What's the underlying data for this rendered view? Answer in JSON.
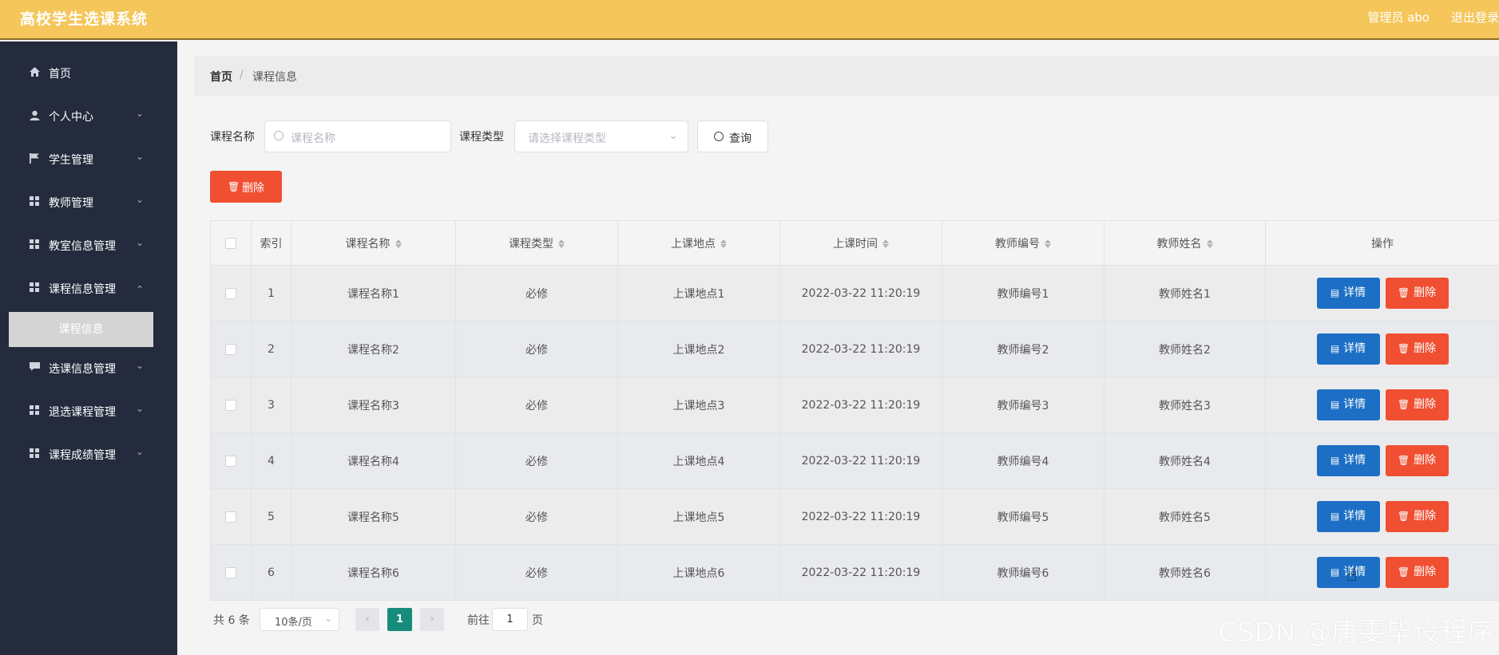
{
  "header": {
    "title": "高校学生选课系统",
    "user": "管理员 abo",
    "logout": "退出登录"
  },
  "sidebar": {
    "items": [
      {
        "label": "首页",
        "icon": "home-icon"
      },
      {
        "label": "个人中心",
        "icon": "user-icon"
      },
      {
        "label": "学生管理",
        "icon": "flag-icon"
      },
      {
        "label": "教师管理",
        "icon": "grid-icon"
      },
      {
        "label": "教室信息管理",
        "icon": "grid-icon"
      },
      {
        "label": "课程信息管理",
        "icon": "grid-icon"
      },
      {
        "label": "选课信息管理",
        "icon": "message-icon"
      },
      {
        "label": "退选课程管理",
        "icon": "grid-icon"
      },
      {
        "label": "课程成绩管理",
        "icon": "grid-icon"
      }
    ],
    "sub_item": "课程信息"
  },
  "breadcrumb": {
    "home": "首页",
    "separator": "/",
    "current": "课程信息"
  },
  "search": {
    "name_label": "课程名称",
    "name_placeholder": "课程名称",
    "type_label": "课程类型",
    "type_placeholder": "请选择课程类型",
    "query_button": "查询"
  },
  "actions": {
    "delete_button": "删除"
  },
  "table": {
    "headers": [
      "索引",
      "课程名称",
      "课程类型",
      "上课地点",
      "上课时间",
      "教师编号",
      "教师姓名",
      "操作"
    ],
    "detail_label": "详情",
    "delete_label": "删除",
    "rows": [
      {
        "index": "1",
        "name": "课程名称1",
        "type": "必修",
        "location": "上课地点1",
        "time": "2022-03-22 11:20:19",
        "teacher_no": "教师编号1",
        "teacher_name": "教师姓名1"
      },
      {
        "index": "2",
        "name": "课程名称2",
        "type": "必修",
        "location": "上课地点2",
        "time": "2022-03-22 11:20:19",
        "teacher_no": "教师编号2",
        "teacher_name": "教师姓名2"
      },
      {
        "index": "3",
        "name": "课程名称3",
        "type": "必修",
        "location": "上课地点3",
        "time": "2022-03-22 11:20:19",
        "teacher_no": "教师编号3",
        "teacher_name": "教师姓名3"
      },
      {
        "index": "4",
        "name": "课程名称4",
        "type": "必修",
        "location": "上课地点4",
        "time": "2022-03-22 11:20:19",
        "teacher_no": "教师编号4",
        "teacher_name": "教师姓名4"
      },
      {
        "index": "5",
        "name": "课程名称5",
        "type": "必修",
        "location": "上课地点5",
        "time": "2022-03-22 11:20:19",
        "teacher_no": "教师编号5",
        "teacher_name": "教师姓名5"
      },
      {
        "index": "6",
        "name": "课程名称6",
        "type": "必修",
        "location": "上课地点6",
        "time": "2022-03-22 11:20:19",
        "teacher_no": "教师编号6",
        "teacher_name": "教师姓名6"
      }
    ]
  },
  "pagination": {
    "total": "共 6 条",
    "page_size": "10条/页",
    "current_page": "1",
    "goto_label": "前往",
    "goto_value": "1",
    "goto_unit": "页"
  },
  "watermark": "CSDN @唐雯毕设程序",
  "colors": {
    "header": "#f5c65a",
    "sidebar": "#232b3d",
    "primary": "#1c6fc4",
    "danger": "#f04f32",
    "page_active": "#178c7c"
  }
}
